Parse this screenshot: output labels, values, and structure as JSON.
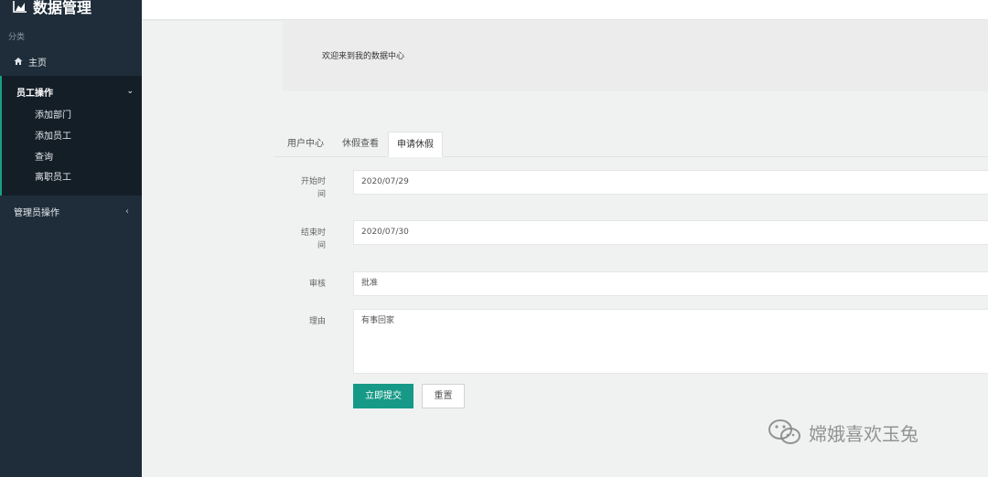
{
  "sidebar": {
    "brand": "数据管理",
    "category_label": "分类",
    "home": "主页",
    "group": {
      "label": "员工操作",
      "items": [
        "添加部门",
        "添加员工",
        "查询",
        "离职员工"
      ]
    },
    "admin": "管理员操作"
  },
  "welcome": {
    "text": "欢迎来到我的数据中心"
  },
  "tabs": [
    {
      "label": "用户中心",
      "active": false
    },
    {
      "label": "休假查看",
      "active": false
    },
    {
      "label": "申请休假",
      "active": true
    }
  ],
  "form": {
    "start_label_1": "开始时",
    "start_label_2": "间",
    "start_value": "2020/07/29",
    "end_label_1": "结束时",
    "end_label_2": "间",
    "end_value": "2020/07/30",
    "review_label": "审核",
    "review_value": "批准",
    "reason_label": "理由",
    "reason_value": "有事回家",
    "submit_label": "立即提交",
    "reset_label": "重置"
  },
  "watermark": {
    "text": "嫦娥喜欢玉兔"
  },
  "colors": {
    "sidebar_bg": "#1f2d3a",
    "accent": "#169a87"
  }
}
